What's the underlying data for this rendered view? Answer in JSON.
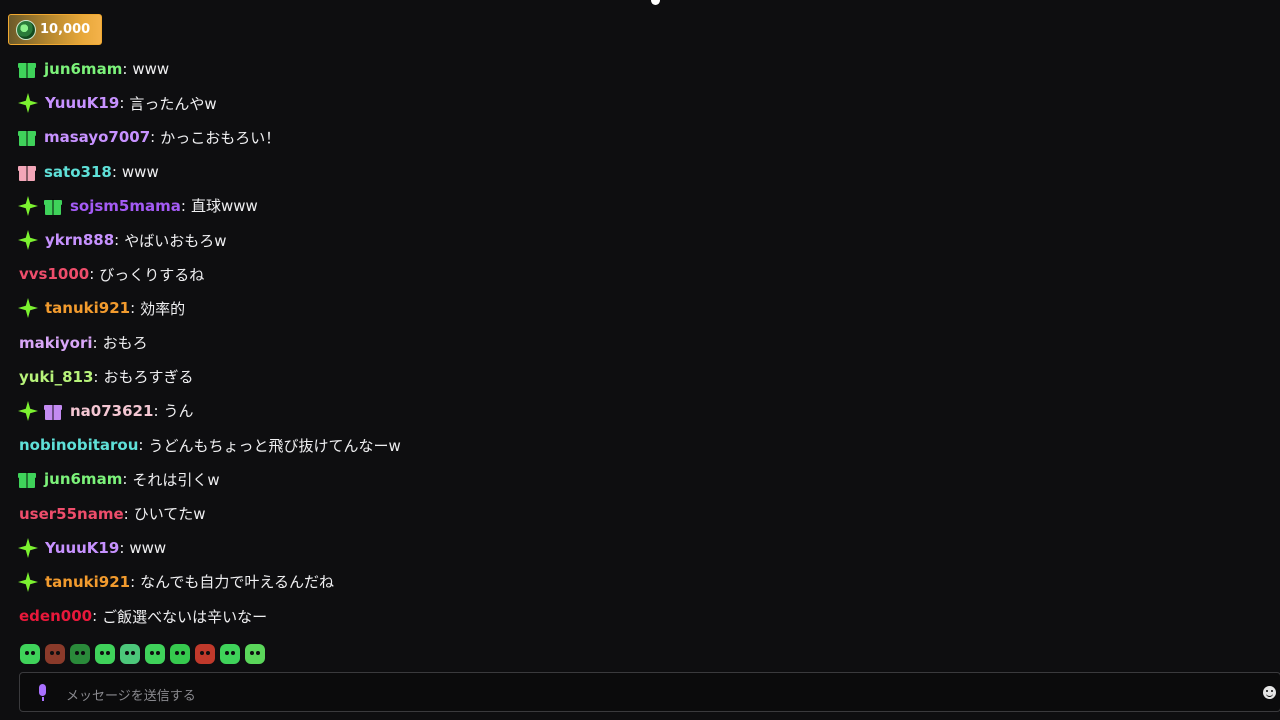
{
  "channel_points": {
    "value": "10,000"
  },
  "chat": {
    "separator": ":",
    "messages": [
      {
        "badges": [
          "gift-green"
        ],
        "user": "jun6mam",
        "color": "#7cf27a",
        "text": "www"
      },
      {
        "badges": [
          "sparkle"
        ],
        "user": "YuuuK19",
        "color": "#c792ff",
        "text": "言ったんやw"
      },
      {
        "badges": [
          "gift-green"
        ],
        "user": "masayo7007",
        "color": "#c792ff",
        "text": "かっこおもろい！"
      },
      {
        "badges": [
          "gift-pink"
        ],
        "user": "sato318",
        "color": "#5fe0d8",
        "text": "www"
      },
      {
        "badges": [
          "sparkle",
          "gift-green"
        ],
        "user": "sojsm5mama",
        "color": "#a45bf5",
        "text": "直球www"
      },
      {
        "badges": [
          "sparkle"
        ],
        "user": "ykrn888",
        "color": "#c792ff",
        "text": "やばいおもろw"
      },
      {
        "badges": [],
        "user": "vvs1000",
        "color": "#ee4d6b",
        "text": "びっくりするね"
      },
      {
        "badges": [
          "sparkle"
        ],
        "user": "tanuki921",
        "color": "#f29b2e",
        "text": "効率的"
      },
      {
        "badges": [],
        "user": "makiyori",
        "color": "#d8a6f7",
        "text": "おもろ"
      },
      {
        "badges": [],
        "user": "yuki_813",
        "color": "#b7f27a",
        "text": "おもろすぎる"
      },
      {
        "badges": [
          "sparkle",
          "gift-purple"
        ],
        "user": "na073621",
        "color": "#f4c7d3",
        "text": "うん"
      },
      {
        "badges": [],
        "user": "nobinobitarou",
        "color": "#5fe0d8",
        "text": "うどんもちょっと飛び抜けてんなーw"
      },
      {
        "badges": [
          "gift-green"
        ],
        "user": "jun6mam",
        "color": "#7cf27a",
        "text": "それは引くw"
      },
      {
        "badges": [],
        "user": "user55name",
        "color": "#ee4d6b",
        "text": "ひいてたw"
      },
      {
        "badges": [
          "sparkle"
        ],
        "user": "YuuuK19",
        "color": "#c792ff",
        "text": "www"
      },
      {
        "badges": [
          "sparkle"
        ],
        "user": "tanuki921",
        "color": "#f29b2e",
        "text": "なんでも自力で叶えるんだね"
      },
      {
        "badges": [],
        "user": "eden000",
        "color": "#e8183a",
        "text": "ご飯選べないは辛いなー"
      }
    ]
  },
  "emote_bar": {
    "emotes": [
      {
        "icon": "green-face-emote",
        "color": "#3fd25a"
      },
      {
        "icon": "brown-face-emote",
        "color": "#8a3a2a"
      },
      {
        "icon": "coin-face-emote",
        "color": "#2a8a3a"
      },
      {
        "icon": "green-blob-emote",
        "color": "#3fd25a"
      },
      {
        "icon": "green-eye-emote",
        "color": "#4cc77a"
      },
      {
        "icon": "green-frog-emote",
        "color": "#3fd25a"
      },
      {
        "icon": "green-frog2-emote",
        "color": "#36c94e"
      },
      {
        "icon": "mushroom-emote",
        "color": "#c0392b"
      },
      {
        "icon": "green-cry-emote",
        "color": "#3fd25a"
      },
      {
        "icon": "green-laugh-emote",
        "color": "#5ad65a"
      }
    ]
  },
  "input": {
    "placeholder": "メッセージを送信する",
    "mic_icon": "microphone-icon",
    "emoji_icon": "smiley-icon"
  },
  "colors": {
    "background": "#0e0e10",
    "accent": "#a970ff",
    "sparkle_badge": "#7cf230"
  }
}
